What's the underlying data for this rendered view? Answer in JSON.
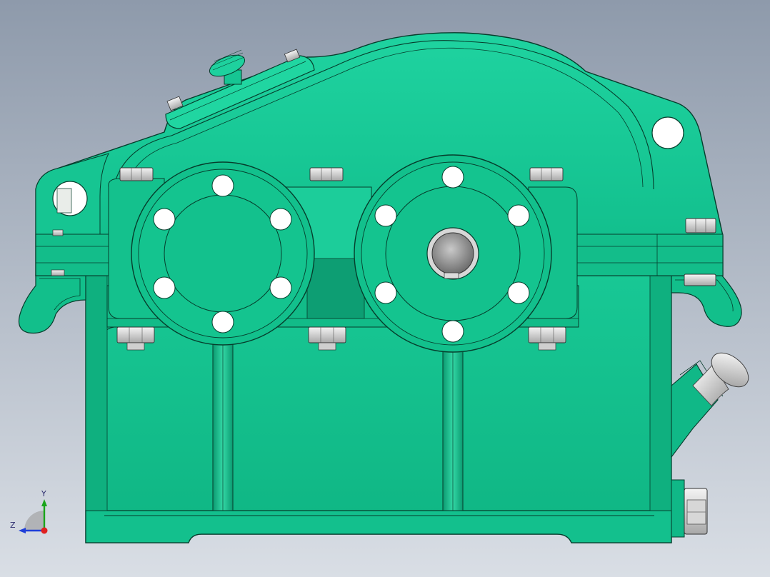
{
  "viewport": {
    "background_top": "#8e9aab",
    "background_bottom": "#d9dee5"
  },
  "model": {
    "body_color": "#10bd8a",
    "body_light": "#1fd29c",
    "body_dark": "#0a9c70",
    "edge_color": "#063d2c",
    "bolt_color": "#dcdcdc",
    "bearing_hole_color": "#ffffff",
    "parts": [
      "housing-base",
      "housing-cover",
      "inspection-cover",
      "vent-plug",
      "bearing-cap-left",
      "bearing-cap-right",
      "output-shaft-end",
      "lifting-lug-left",
      "lifting-lug-right",
      "oil-dipstick",
      "drain-plug"
    ]
  },
  "triad": {
    "x_color": "#e02020",
    "y_color": "#1aa51a",
    "z_color": "#1f3fd8",
    "y_label": "Y",
    "z_label": "Z"
  }
}
